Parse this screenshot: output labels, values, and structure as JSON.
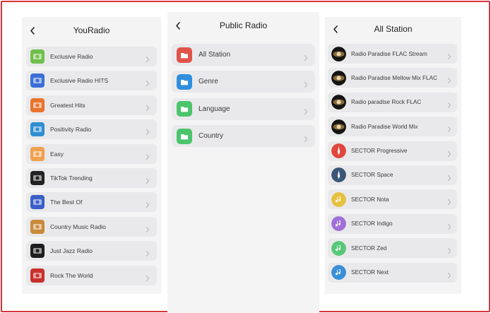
{
  "panels": {
    "youradio": {
      "title": "YouRadio",
      "items": [
        {
          "label": "Exclusive Radio",
          "color": "#6fbf4a",
          "icon": "exclusive-radio-logo-icon"
        },
        {
          "label": "Exclusive Radio HITS",
          "color": "#3b6fd6",
          "icon": "exclusive-hits-logo-icon"
        },
        {
          "label": "Greatest Hits",
          "color": "#e8742f",
          "icon": "greatest-hits-logo-icon"
        },
        {
          "label": "Positivity Radio",
          "color": "#2f8fd0",
          "icon": "positivity-logo-icon"
        },
        {
          "label": "Easy",
          "color": "#f0a050",
          "icon": "easy-logo-icon"
        },
        {
          "label": "TikTok Trending",
          "color": "#222222",
          "icon": "tiktok-logo-icon"
        },
        {
          "label": "The Best Of",
          "color": "#3a5fc8",
          "icon": "best-of-logo-icon"
        },
        {
          "label": "Country Music Radio",
          "color": "#c98a3a",
          "icon": "country-logo-icon"
        },
        {
          "label": "Just Jazz Radio",
          "color": "#1d1d1d",
          "icon": "jazz-logo-icon"
        },
        {
          "label": "Rock The World",
          "color": "#c8302c",
          "icon": "rock-logo-icon"
        }
      ]
    },
    "public": {
      "title": "Public Radio",
      "items": [
        {
          "label": "All Station",
          "color": "#e2544a",
          "icon": "folder-icon"
        },
        {
          "label": "Genre",
          "color": "#2f8fdc",
          "icon": "folder-icon"
        },
        {
          "label": "Language",
          "color": "#4cc46c",
          "icon": "folder-icon"
        },
        {
          "label": "Country",
          "color": "#4cc46c",
          "icon": "folder-icon"
        }
      ]
    },
    "allstation": {
      "title": "All Station",
      "items": [
        {
          "label": "Radio Paradise FLAC Stream",
          "color": "#1a1a1a",
          "icon": "radio-paradise-logo-icon"
        },
        {
          "label": "Radio Paradise Mellow Mix FLAC",
          "color": "#1a1a1a",
          "icon": "radio-paradise-logo-icon"
        },
        {
          "label": "Radio paradise Rock FLAC",
          "color": "#1a1a1a",
          "icon": "radio-paradise-logo-icon"
        },
        {
          "label": "Radio Paradise World Mix",
          "color": "#1a1a1a",
          "icon": "radio-paradise-logo-icon"
        },
        {
          "label": "SECTOR Progressive",
          "color": "#e0463c",
          "icon": "sector-rocket-icon"
        },
        {
          "label": "SECTOR Space",
          "color": "#3a5678",
          "icon": "sector-rocket-icon"
        },
        {
          "label": "SECTOR Nota",
          "color": "#e6c040",
          "icon": "music-note-icon"
        },
        {
          "label": "SECTOR Indigo",
          "color": "#a070d8",
          "icon": "music-note-icon"
        },
        {
          "label": "SECTOR Zed",
          "color": "#58c878",
          "icon": "music-note-icon"
        },
        {
          "label": "SECTOR Next",
          "color": "#3a8fd8",
          "icon": "music-note-icon"
        }
      ]
    }
  }
}
